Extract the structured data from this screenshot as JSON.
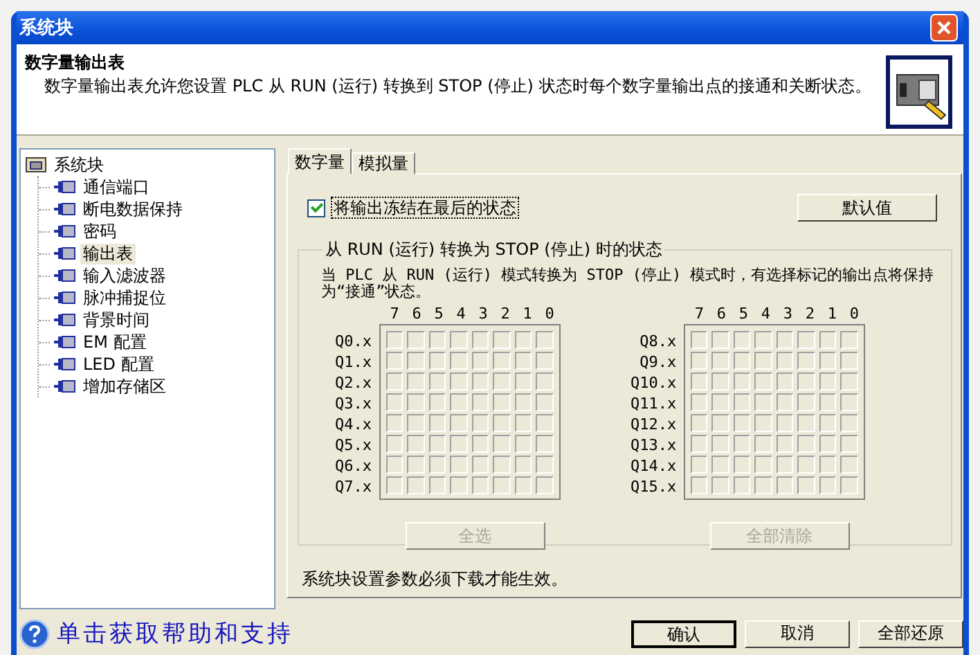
{
  "window": {
    "title": "系统块"
  },
  "header": {
    "title": "数字量输出表",
    "description": "数字量输出表允许您设置 PLC 从 RUN (运行) 转换到 STOP (停止) 状态时每个数字量输出点的接通和关断状态。"
  },
  "tree": {
    "label": "系统块",
    "expanded": true,
    "selected": false,
    "children": [
      {
        "label": "通信端口",
        "selected": false
      },
      {
        "label": "断电数据保持",
        "selected": false
      },
      {
        "label": "密码",
        "selected": false
      },
      {
        "label": "输出表",
        "selected": true
      },
      {
        "label": "输入滤波器",
        "selected": false
      },
      {
        "label": "脉冲捕捉位",
        "selected": false
      },
      {
        "label": "背景时间",
        "selected": false
      },
      {
        "label": "EM 配置",
        "selected": false
      },
      {
        "label": "LED 配置",
        "selected": false
      },
      {
        "label": "增加存储区",
        "selected": false
      }
    ]
  },
  "tabs": [
    {
      "label": "数字量",
      "selected": true
    },
    {
      "label": "模拟量",
      "selected": false
    }
  ],
  "freeze_checkbox": {
    "label": "将输出冻结在最后的状态",
    "checked": true
  },
  "default_button": "默认值",
  "group": {
    "legend": "从 RUN (运行) 转换为 STOP (停止) 时的状态",
    "description": "当 PLC 从 RUN (运行) 模式转换为 STOP (停止) 模式时，有选择标记的输出点将保持为“接通”状态。",
    "grids": [
      {
        "bit_headers": [
          "7",
          "6",
          "5",
          "4",
          "3",
          "2",
          "1",
          "0"
        ],
        "button": {
          "label": "全选",
          "disabled": true
        },
        "rows": [
          {
            "label": "Q0.x",
            "bits": [
              false,
              false,
              false,
              false,
              false,
              false,
              false,
              false
            ]
          },
          {
            "label": "Q1.x",
            "bits": [
              false,
              false,
              false,
              false,
              false,
              false,
              false,
              false
            ]
          },
          {
            "label": "Q2.x",
            "bits": [
              false,
              false,
              false,
              false,
              false,
              false,
              false,
              false
            ]
          },
          {
            "label": "Q3.x",
            "bits": [
              false,
              false,
              false,
              false,
              false,
              false,
              false,
              false
            ]
          },
          {
            "label": "Q4.x",
            "bits": [
              false,
              false,
              false,
              false,
              false,
              false,
              false,
              false
            ]
          },
          {
            "label": "Q5.x",
            "bits": [
              false,
              false,
              false,
              false,
              false,
              false,
              false,
              false
            ]
          },
          {
            "label": "Q6.x",
            "bits": [
              false,
              false,
              false,
              false,
              false,
              false,
              false,
              false
            ]
          },
          {
            "label": "Q7.x",
            "bits": [
              false,
              false,
              false,
              false,
              false,
              false,
              false,
              false
            ]
          }
        ]
      },
      {
        "bit_headers": [
          "7",
          "6",
          "5",
          "4",
          "3",
          "2",
          "1",
          "0"
        ],
        "button": {
          "label": "全部清除",
          "disabled": true
        },
        "rows": [
          {
            "label": "Q8.x",
            "bits": [
              false,
              false,
              false,
              false,
              false,
              false,
              false,
              false
            ]
          },
          {
            "label": "Q9.x",
            "bits": [
              false,
              false,
              false,
              false,
              false,
              false,
              false,
              false
            ]
          },
          {
            "label": "Q10.x",
            "bits": [
              false,
              false,
              false,
              false,
              false,
              false,
              false,
              false
            ]
          },
          {
            "label": "Q11.x",
            "bits": [
              false,
              false,
              false,
              false,
              false,
              false,
              false,
              false
            ]
          },
          {
            "label": "Q12.x",
            "bits": [
              false,
              false,
              false,
              false,
              false,
              false,
              false,
              false
            ]
          },
          {
            "label": "Q13.x",
            "bits": [
              false,
              false,
              false,
              false,
              false,
              false,
              false,
              false
            ]
          },
          {
            "label": "Q14.x",
            "bits": [
              false,
              false,
              false,
              false,
              false,
              false,
              false,
              false
            ]
          },
          {
            "label": "Q15.x",
            "bits": [
              false,
              false,
              false,
              false,
              false,
              false,
              false,
              false
            ]
          }
        ]
      }
    ]
  },
  "note": "系统块设置参数必须下载才能生效。",
  "help_link": "单击获取帮助和支持",
  "buttons": [
    "确认",
    "取消",
    "全部还原"
  ]
}
